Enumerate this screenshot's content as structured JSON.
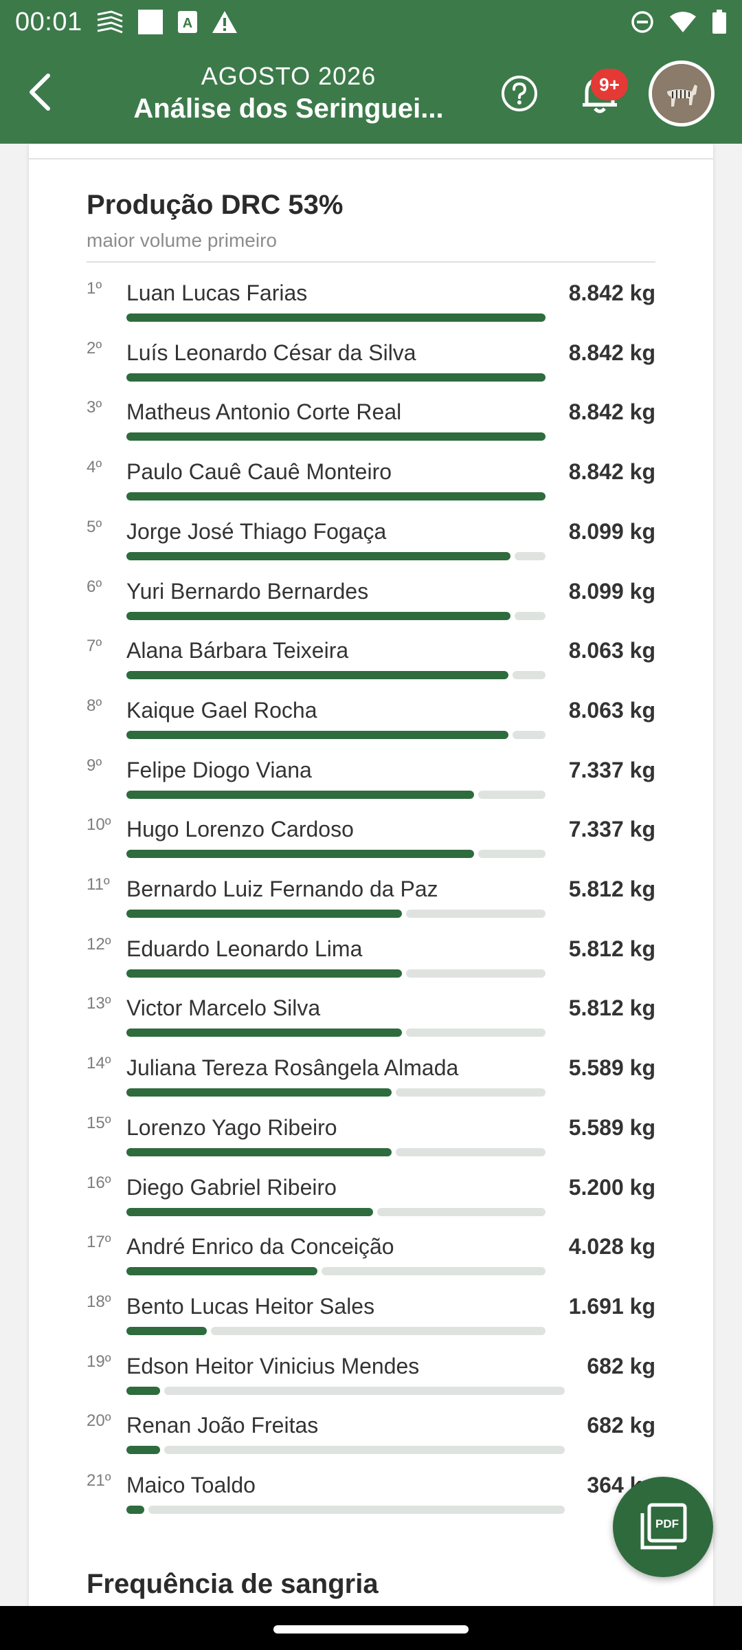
{
  "status": {
    "time": "00:01",
    "left_icons": [
      "wind-icon",
      "square-icon",
      "a-box-icon",
      "warning-icon"
    ],
    "right_icons": [
      "dnd-icon",
      "wifi-icon",
      "battery-icon"
    ]
  },
  "header": {
    "month": "AGOSTO 2026",
    "title": "Análise dos Seringuei...",
    "notifications_badge": "9+",
    "theme_color": "#3c7a4a",
    "badge_color": "#e53935"
  },
  "section": {
    "title": "Produção DRC 53%",
    "subtitle": "maior volume primeiro",
    "bar_color": "#2e6b3d",
    "track_color": "#dfe3df"
  },
  "ranking": [
    {
      "rank": "1º",
      "name": "Luan Lucas Farias",
      "value": "8.842 kg",
      "kg": 8842
    },
    {
      "rank": "2º",
      "name": "Luís Leonardo César da Silva",
      "value": "8.842 kg",
      "kg": 8842
    },
    {
      "rank": "3º",
      "name": "Matheus Antonio Corte Real",
      "value": "8.842 kg",
      "kg": 8842
    },
    {
      "rank": "4º",
      "name": "Paulo Cauê Cauê Monteiro",
      "value": "8.842 kg",
      "kg": 8842
    },
    {
      "rank": "5º",
      "name": "Jorge José Thiago Fogaça",
      "value": "8.099 kg",
      "kg": 8099
    },
    {
      "rank": "6º",
      "name": "Yuri Bernardo Bernardes",
      "value": "8.099 kg",
      "kg": 8099
    },
    {
      "rank": "7º",
      "name": "Alana Bárbara Teixeira",
      "value": "8.063 kg",
      "kg": 8063
    },
    {
      "rank": "8º",
      "name": "Kaique Gael Rocha",
      "value": "8.063 kg",
      "kg": 8063
    },
    {
      "rank": "9º",
      "name": "Felipe Diogo Viana",
      "value": "7.337 kg",
      "kg": 7337
    },
    {
      "rank": "10º",
      "name": "Hugo Lorenzo Cardoso",
      "value": "7.337 kg",
      "kg": 7337
    },
    {
      "rank": "11º",
      "name": "Bernardo Luiz Fernando da Paz",
      "value": "5.812 kg",
      "kg": 5812
    },
    {
      "rank": "12º",
      "name": "Eduardo Leonardo Lima",
      "value": "5.812 kg",
      "kg": 5812
    },
    {
      "rank": "13º",
      "name": "Victor Marcelo Silva",
      "value": "5.812 kg",
      "kg": 5812
    },
    {
      "rank": "14º",
      "name": "Juliana Tereza Rosângela Almada",
      "value": "5.589 kg",
      "kg": 5589
    },
    {
      "rank": "15º",
      "name": "Lorenzo Yago Ribeiro",
      "value": "5.589 kg",
      "kg": 5589
    },
    {
      "rank": "16º",
      "name": "Diego Gabriel Ribeiro",
      "value": "5.200 kg",
      "kg": 5200
    },
    {
      "rank": "17º",
      "name": "André Enrico da Conceição",
      "value": "4.028 kg",
      "kg": 4028
    },
    {
      "rank": "18º",
      "name": "Bento Lucas Heitor Sales",
      "value": "1.691 kg",
      "kg": 1691
    },
    {
      "rank": "19º",
      "name": "Edson Heitor Vinicius Mendes",
      "value": "682 kg",
      "kg": 682
    },
    {
      "rank": "20º",
      "name": "Renan João Freitas",
      "value": "682 kg",
      "kg": 682
    },
    {
      "rank": "21º",
      "name": "Maico Toaldo",
      "value": "364 kg",
      "kg": 364
    }
  ],
  "next_section": {
    "title": "Frequência de sangria"
  },
  "fab": {
    "label": "PDF",
    "color": "#2f6a3d"
  }
}
